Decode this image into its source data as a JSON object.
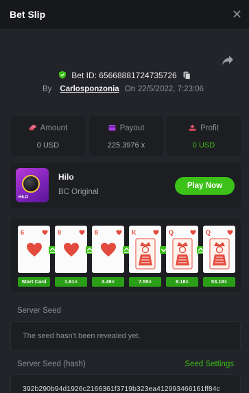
{
  "header": {
    "title": "Bet Slip",
    "close_glyph": "✕"
  },
  "bet": {
    "bet_id_label": "Bet ID: 65668881724735726",
    "by_label": "By",
    "username": "Carlosponzonia",
    "on_label": "On",
    "datetime": "22/5/2022, 7:23:06"
  },
  "stats": {
    "amount": {
      "label": "Amount",
      "value": "0 USD",
      "icon": "coins-icon"
    },
    "payout": {
      "label": "Payout",
      "value": "225.3976 x",
      "icon": "wallet-icon"
    },
    "profit": {
      "label": "Profit",
      "value": "0 USD",
      "icon": "profit-icon"
    }
  },
  "game": {
    "name": "Hilo",
    "provider": "BC Original",
    "logo_tag": "HILO",
    "play_label": "Play Now"
  },
  "cards": [
    {
      "rank": "6",
      "type": "number",
      "multiplier": "Start Card",
      "arrow": "up"
    },
    {
      "rank": "8",
      "type": "number",
      "multiplier": "1.61×",
      "arrow": "up"
    },
    {
      "rank": "8",
      "type": "number",
      "multiplier": "3.49×",
      "arrow": "up"
    },
    {
      "rank": "K",
      "type": "face",
      "multiplier": "7.55×",
      "arrow": "down"
    },
    {
      "rank": "Q",
      "type": "face",
      "multiplier": "8.18×",
      "arrow": "up"
    },
    {
      "rank": "Q",
      "type": "face",
      "multiplier": "53.18×",
      "arrow": ""
    }
  ],
  "seeds": {
    "server_seed_label": "Server Seed",
    "server_seed_value": "The seed hasn't been revealed yet.",
    "server_seed_hash_label": "Server Seed (hash)",
    "seed_settings_label": "Seed Settings",
    "server_seed_hash_value": "392b290b94d1926c2166361f3719b323ea412993466161ff84c"
  },
  "colors": {
    "accent_green": "#3bc117",
    "card_red": "#e24b3d",
    "panel": "#232429",
    "box": "#1d1e22"
  }
}
